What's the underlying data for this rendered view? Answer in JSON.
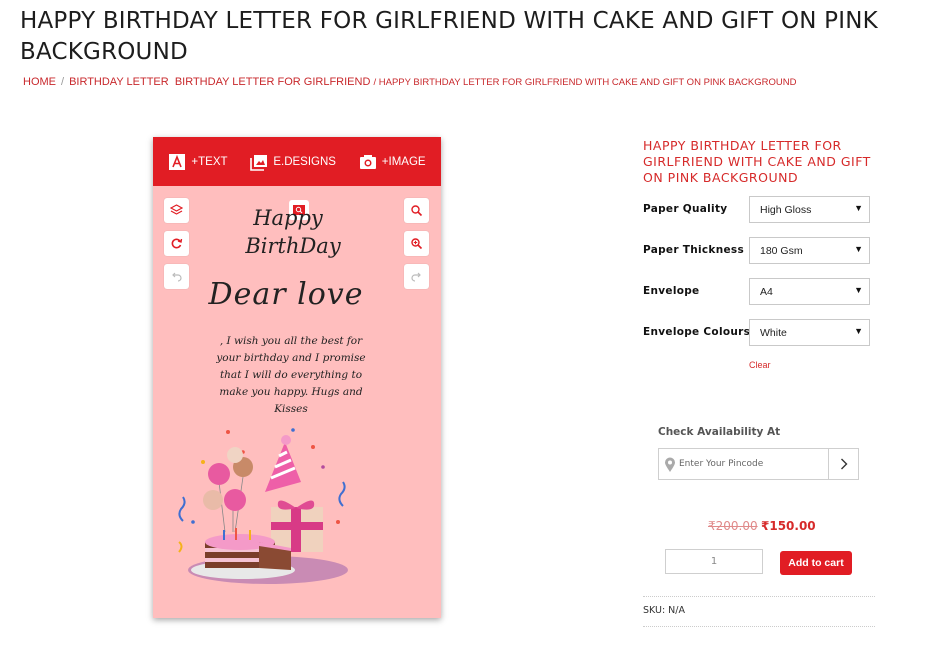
{
  "page": {
    "title": "HAPPY BIRTHDAY LETTER FOR GIRLFRIEND WITH CAKE AND GIFT ON PINK BACKGROUND"
  },
  "breadcrumb": {
    "home": "HOME",
    "cat1": "BIRTHDAY LETTER",
    "cat2": "BIRTHDAY LETTER FOR GIRLFRIEND",
    "current": "/ HAPPY BIRTHDAY LETTER FOR GIRLFRIEND WITH CAKE AND GIFT ON PINK BACKGROUND"
  },
  "editor": {
    "toolbar": {
      "text_label": "+TEXT",
      "designs_label": "E.DESIGNS",
      "image_label": "+IMAGE"
    },
    "card": {
      "happy": "Happy",
      "birthday": "BirthDay",
      "dear": "Dear love",
      "message": ", I wish you all the best for your birthday and I promise that I will do everything to make you happy. Hugs and Kisses"
    },
    "colors": {
      "toolbar": "#e11d24",
      "canvas": "#ffbebe"
    }
  },
  "product": {
    "title": "HAPPY BIRTHDAY LETTER FOR GIRLFRIEND WITH CAKE AND GIFT ON PINK BACKGROUND",
    "options": [
      {
        "label": "Paper Quality",
        "value": "High Gloss"
      },
      {
        "label": "Paper Thickness",
        "value": "180 Gsm"
      },
      {
        "label": "Envelope",
        "value": "A4"
      },
      {
        "label": "Envelope Colours",
        "value": "White"
      }
    ],
    "clear_label": "Clear",
    "availability": {
      "label": "Check Availability At",
      "placeholder": "Enter Your Pincode"
    },
    "price_old": "₹200.00",
    "price_new": "₹150.00",
    "quantity": "1",
    "add_to_cart": "Add to cart",
    "sku": "SKU: N/A",
    "accent_color": "#d62a2a"
  }
}
